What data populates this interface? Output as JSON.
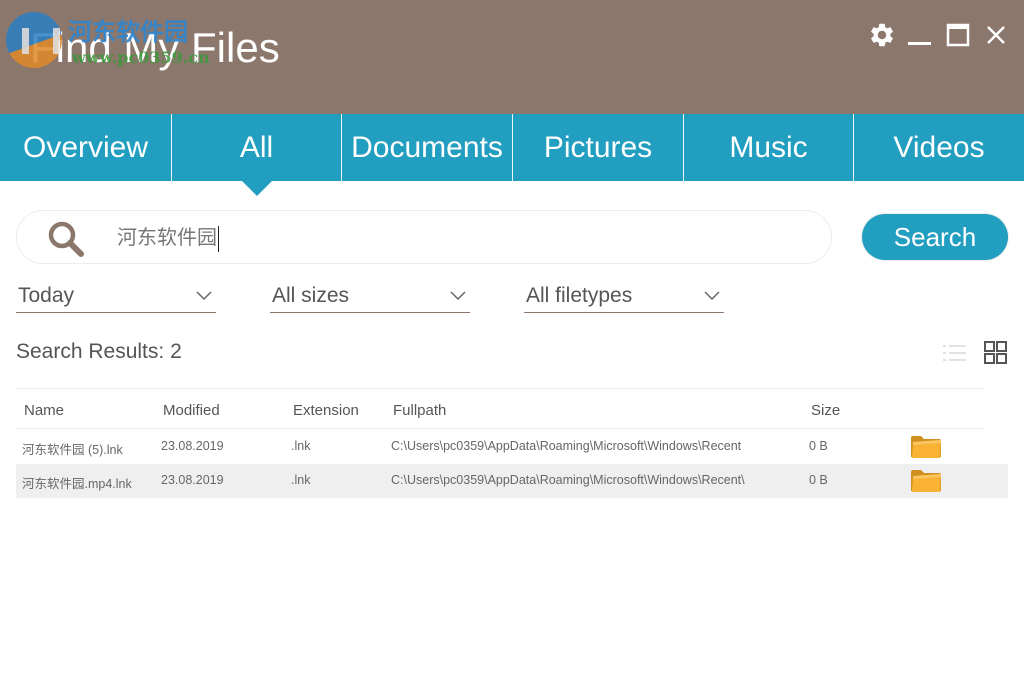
{
  "window": {
    "title": "Find My Files",
    "controls": {
      "settings": "gear-icon",
      "minimize": "minimize-icon",
      "maximize": "maximize-icon",
      "close": "close-icon"
    }
  },
  "watermark": {
    "text_cn": "河东软件园",
    "url": "www.pc0359.cn"
  },
  "tabs": [
    {
      "label": "Overview",
      "active": false
    },
    {
      "label": "All",
      "active": true
    },
    {
      "label": "Documents",
      "active": false
    },
    {
      "label": "Pictures",
      "active": false
    },
    {
      "label": "Music",
      "active": false
    },
    {
      "label": "Videos",
      "active": false
    }
  ],
  "search": {
    "value": "河东软件园",
    "button_label": "Search"
  },
  "filters": {
    "date": "Today",
    "size": "All sizes",
    "filetype": "All filetypes"
  },
  "results": {
    "title": "Search Results:",
    "count": "2",
    "columns": [
      "Name",
      "Modified",
      "Extension",
      "Fullpath",
      "Size"
    ],
    "rows": [
      {
        "name": "河东软件园 (5).lnk",
        "modified": "23.08.2019",
        "extension": ".lnk",
        "fullpath": "C:\\Users\\pc0359\\AppData\\Roaming\\Microsoft\\Windows\\Recent",
        "size": "0 B"
      },
      {
        "name": "河东软件园.mp4.lnk",
        "modified": "23.08.2019",
        "extension": ".lnk",
        "fullpath": "C:\\Users\\pc0359\\AppData\\Roaming\\Microsoft\\Windows\\Recent\\",
        "size": "0 B"
      }
    ]
  },
  "colors": {
    "header": "#8B776C",
    "accent": "#219EC0",
    "folder": "#F9B233"
  }
}
